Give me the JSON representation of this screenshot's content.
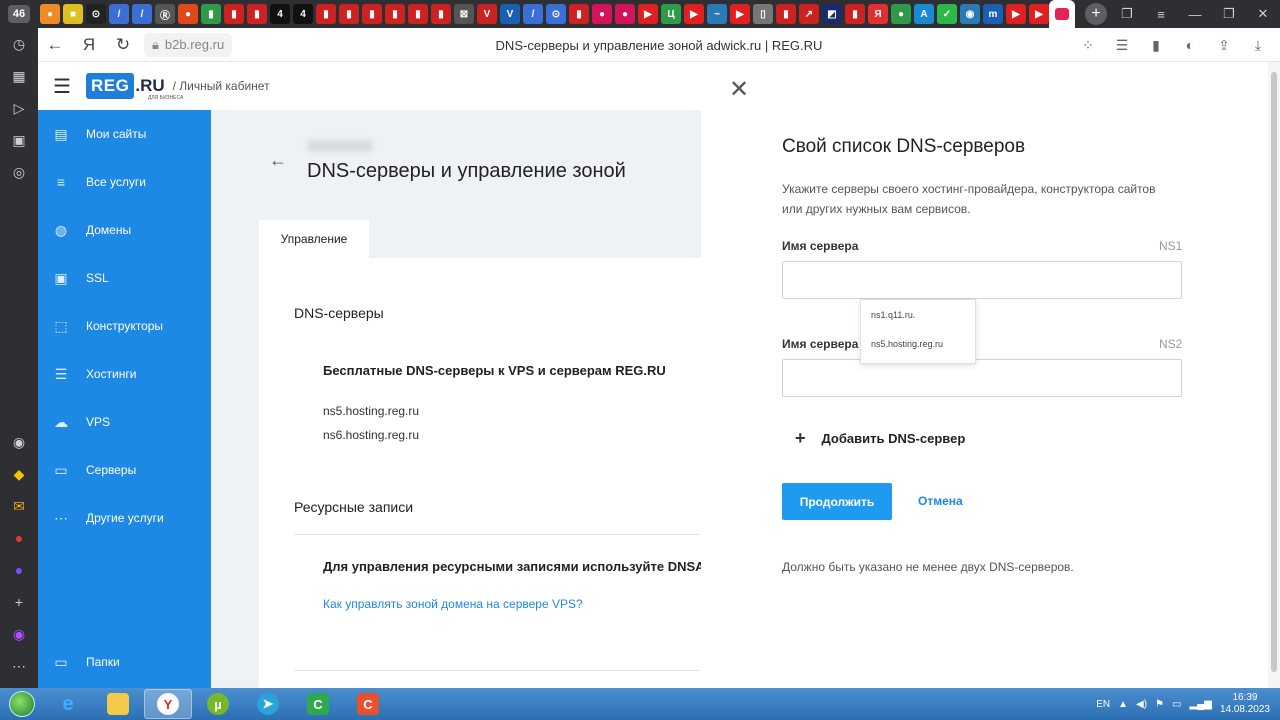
{
  "browser": {
    "tab_count": "46",
    "url": "b2b.reg.ru",
    "page_title": "DNS-серверы и управление зоной adwick.ru | REG.RU",
    "tab_favicons": [
      {
        "color": "#f08a24",
        "glyph": "●"
      },
      {
        "color": "#e0c020",
        "glyph": "■"
      },
      {
        "color": "#222222",
        "glyph": "⊙"
      },
      {
        "color": "#3b6fd6",
        "glyph": "/"
      },
      {
        "color": "#3b6fd6",
        "glyph": "/"
      },
      {
        "color": "#555555",
        "glyph": "Ⓡ"
      },
      {
        "color": "#e04a1a",
        "glyph": "●"
      },
      {
        "color": "#2e9a4a",
        "glyph": "▮"
      },
      {
        "color": "#cc2222",
        "glyph": "▮"
      },
      {
        "color": "#cc2222",
        "glyph": "▮"
      },
      {
        "color": "#111111",
        "glyph": "4"
      },
      {
        "color": "#111111",
        "glyph": "4"
      },
      {
        "color": "#cc2222",
        "glyph": "▮"
      },
      {
        "color": "#cc2222",
        "glyph": "▮"
      },
      {
        "color": "#cc2222",
        "glyph": "▮"
      },
      {
        "color": "#cc2222",
        "glyph": "▮"
      },
      {
        "color": "#cc2222",
        "glyph": "▮"
      },
      {
        "color": "#cc2222",
        "glyph": "▮"
      },
      {
        "color": "#555555",
        "glyph": "⊠"
      },
      {
        "color": "#cc2222",
        "glyph": "V"
      },
      {
        "color": "#1a5fb4",
        "glyph": "V"
      },
      {
        "color": "#3b6fd6",
        "glyph": "/"
      },
      {
        "color": "#3b6fd6",
        "glyph": "⊙"
      },
      {
        "color": "#cc2222",
        "glyph": "▮"
      },
      {
        "color": "#d4145a",
        "glyph": "●"
      },
      {
        "color": "#d4145a",
        "glyph": "●"
      },
      {
        "color": "#e02020",
        "glyph": "▶"
      },
      {
        "color": "#2e9a4a",
        "glyph": "Ц"
      },
      {
        "color": "#e02020",
        "glyph": "▶"
      },
      {
        "color": "#2a7ab8",
        "glyph": "~"
      },
      {
        "color": "#e02020",
        "glyph": "▶"
      },
      {
        "color": "#777777",
        "glyph": "▯"
      },
      {
        "color": "#cc2222",
        "glyph": "▮"
      },
      {
        "color": "#cc2222",
        "glyph": "↗"
      },
      {
        "color": "#1a2a6b",
        "glyph": "◩"
      },
      {
        "color": "#cc2222",
        "glyph": "▮"
      },
      {
        "color": "#e03030",
        "glyph": "Я"
      },
      {
        "color": "#2e9a4a",
        "glyph": "●"
      },
      {
        "color": "#1a8ad4",
        "glyph": "A"
      },
      {
        "color": "#2eb84a",
        "glyph": "✓"
      },
      {
        "color": "#2a7ab8",
        "glyph": "◉"
      },
      {
        "color": "#1a5fb4",
        "glyph": "m"
      },
      {
        "color": "#e02020",
        "glyph": "▶"
      },
      {
        "color": "#e02020",
        "glyph": "▶"
      }
    ]
  },
  "site": {
    "logo_text": "REG",
    "logo_suffix": ".RU",
    "logo_sub": "ДЛЯ БИЗНЕСА",
    "breadcrumb": "/ Личный кабинет"
  },
  "sidebar": {
    "items": [
      {
        "label": "Мои сайты",
        "icon": "sites-icon",
        "glyph": "▤"
      },
      {
        "label": "Все услуги",
        "icon": "list-icon",
        "glyph": "≡"
      },
      {
        "label": "Домены",
        "icon": "globe-icon",
        "glyph": "◍"
      },
      {
        "label": "SSL",
        "icon": "ssl-icon",
        "glyph": "▣"
      },
      {
        "label": "Конструкторы",
        "icon": "builder-icon",
        "glyph": "⬚"
      },
      {
        "label": "Хостинги",
        "icon": "hosting-icon",
        "glyph": "☰"
      },
      {
        "label": "VPS",
        "icon": "vps-icon",
        "glyph": "☁"
      },
      {
        "label": "Серверы",
        "icon": "server-icon",
        "glyph": "▭"
      },
      {
        "label": "Другие услуги",
        "icon": "more-icon",
        "glyph": "⋯"
      }
    ],
    "folders_label": "Папки"
  },
  "main": {
    "title": "DNS-серверы и управление зоной",
    "tab_label": "Управление",
    "dns_section": "DNS-серверы",
    "free_dns_title": "Бесплатные DNS-серверы к VPS и серверам REG.RU",
    "ns_list": [
      "ns5.hosting.reg.ru",
      "ns6.hosting.reg.ru"
    ],
    "records_section": "Ресурсные записи",
    "records_text": "Для управления ресурсными записями используйте DNSAdmin",
    "records_link": "Как управлять зоной домена на сервере VPS?"
  },
  "panel": {
    "title": "Свой список DNS-серверов",
    "description": "Укажите серверы своего хостинг-провайдера, конструктора сайтов или других нужных вам сервисов.",
    "field1_label": "Имя сервера",
    "field1_tag": "NS1",
    "field1_value": "",
    "field2_label": "Имя сервера",
    "field2_tag": "NS2",
    "field2_value": "",
    "suggestions": [
      "ns1.q11.ru.",
      "ns5.hosting.reg.ru"
    ],
    "add_label": "Добавить DNS-сервер",
    "continue_label": "Продолжить",
    "cancel_label": "Отмена",
    "note": "Должно быть указано не менее двух DNS-серверов."
  },
  "taskbar": {
    "lang": "EN",
    "time": "16:39",
    "date": "14.08.2023"
  }
}
